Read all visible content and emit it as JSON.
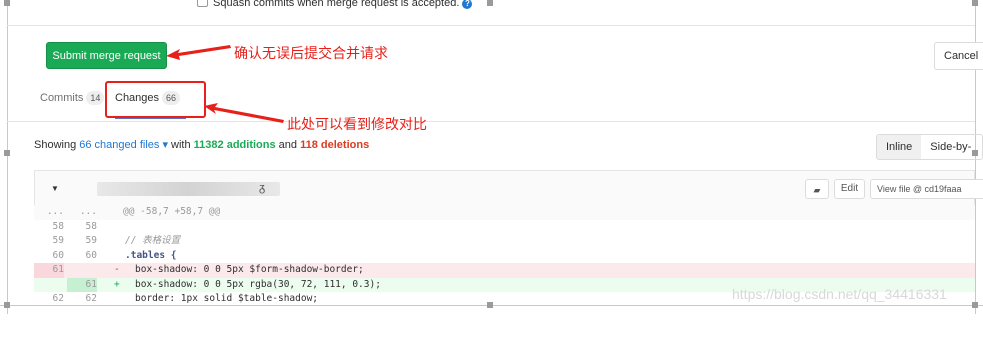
{
  "merge": {
    "squash_text": "Squash commits when merge request is accepted.",
    "submit_label": "Submit merge request",
    "cancel_label": "Cancel"
  },
  "annotations": {
    "submit_note": "确认无误后提交合并请求",
    "changes_note": "此处可以看到修改对比"
  },
  "tabs": [
    {
      "label": "Commits",
      "count": "14"
    },
    {
      "label": "Changes",
      "count": "66"
    }
  ],
  "summary": {
    "showing": "Showing",
    "changed_files": "66 changed files",
    "with": "with",
    "additions": "11382 additions",
    "and": "and",
    "deletions": "118 deletions"
  },
  "view_toggle": {
    "inline": "Inline",
    "side_by_side": "Side-by-si"
  },
  "file_header": {
    "edit_label": "Edit",
    "view_file_label": "View file @ cd19faaa"
  },
  "diff": {
    "hunk": {
      "old": "...",
      "new": "...",
      "text": "@@ -58,7 +58,7 @@"
    },
    "lines": [
      {
        "old": "58",
        "new": "58",
        "sign": " ",
        "type": "context",
        "text": ""
      },
      {
        "old": "59",
        "new": "59",
        "sign": " ",
        "type": "context",
        "text": "// 表格设置"
      },
      {
        "old": "60",
        "new": "60",
        "sign": " ",
        "type": "context",
        "text": ".tables {"
      },
      {
        "old": "61",
        "new": "",
        "sign": "-",
        "type": "old",
        "text": "box-shadow: 0 0 5px $form-shadow-border;"
      },
      {
        "old": "",
        "new": "61",
        "sign": "+",
        "type": "new",
        "text": "box-shadow: 0 0 5px rgba(30, 72, 111, 0.3);"
      },
      {
        "old": "62",
        "new": "62",
        "sign": " ",
        "type": "context",
        "text": "border: 1px solid $table-shadow;"
      }
    ]
  },
  "watermark": "https://blog.csdn.net/qq_34416331"
}
